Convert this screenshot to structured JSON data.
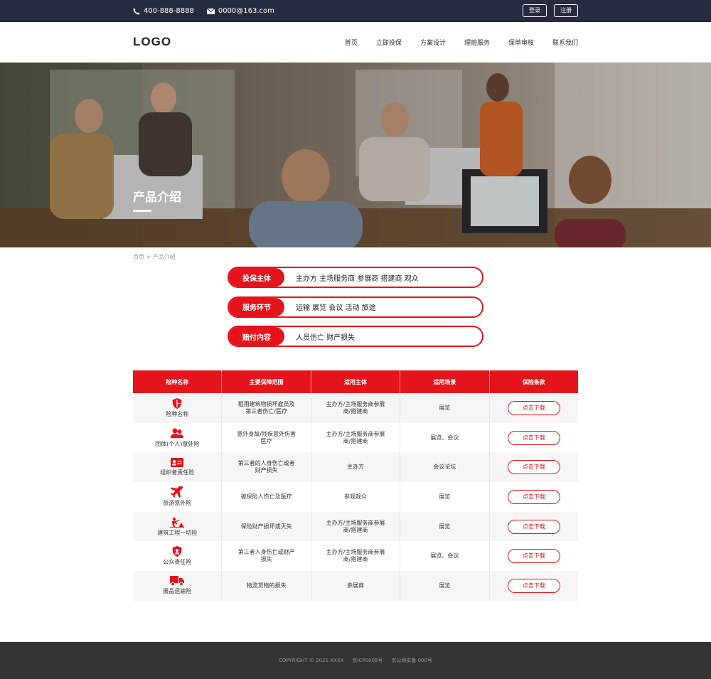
{
  "topbar": {
    "phone": "400-888-8888",
    "email": "0000@163.com",
    "login": "登录",
    "register": "注册"
  },
  "header": {
    "logo": "LOGO",
    "nav": [
      "首页",
      "立即投保",
      "方案设计",
      "理赔服务",
      "保单审核",
      "联系我们"
    ]
  },
  "banner": {
    "title": "产品介绍"
  },
  "breadcrumb": "首页 > 产品介绍",
  "pills": [
    {
      "label": "投保主体",
      "value": "主办方 主场服务商 参展商 搭建商 观众"
    },
    {
      "label": "服务环节",
      "value": "运输 展览 会议 活动 旅途"
    },
    {
      "label": "赔付内容",
      "value": "人员伤亡 财产损失"
    }
  ],
  "table": {
    "headers": [
      "险种名称",
      "主要保障范围",
      "适用主体",
      "适用场景",
      "保险条款"
    ],
    "rows": [
      {
        "icon": "shield-icon",
        "name": "险种名称",
        "scope": "租用建筑物损坏雇员及第三者伤亡/医疗",
        "subject": "主办方/主场服务商参展商/搭建商",
        "scene": "展览",
        "action": "点击下载"
      },
      {
        "icon": "users-icon",
        "name": "团体(个人)意外险",
        "scope": "意外身故/残疾意外伤害医疗",
        "subject": "主办方/主场服务商参展商/搭建商",
        "scene": "展览、会议",
        "action": "点击下载"
      },
      {
        "icon": "id-card-icon",
        "name": "组织者责任险",
        "scope": "第三者的人身伤亡或者财产损失",
        "subject": "主办方",
        "scene": "会议论坛",
        "action": "点击下载"
      },
      {
        "icon": "airplane-icon",
        "name": "旅游意外险",
        "scope": "被保险人伤亡及医疗",
        "subject": "参观观众",
        "scene": "展览",
        "action": "点击下载"
      },
      {
        "icon": "construction-icon",
        "name": "建筑工程一切险",
        "scope": "保险财产损坏或灭失",
        "subject": "主办方/主场服务商参展商/搭建商",
        "scene": "展览",
        "action": "点击下载"
      },
      {
        "icon": "badge-shield-icon",
        "name": "公众责任险",
        "scope": "第三者人身伤亡或财产损失",
        "subject": "主办方/主场服务商参展商/搭建商",
        "scene": "展览、会议",
        "action": "点击下载"
      },
      {
        "icon": "truck-icon",
        "name": "展品运输险",
        "scope": "物流货物的损失",
        "subject": "参展商",
        "scene": "展览",
        "action": "点击下载"
      }
    ]
  },
  "footer": {
    "copyright": "COPYRIGHT © 2021 XXXX",
    "icp": "京ICP0005号",
    "police": "京公网安备 000号"
  },
  "colors": {
    "accent": "#e5131b",
    "topbar": "#262b3f",
    "footer": "#333333"
  }
}
